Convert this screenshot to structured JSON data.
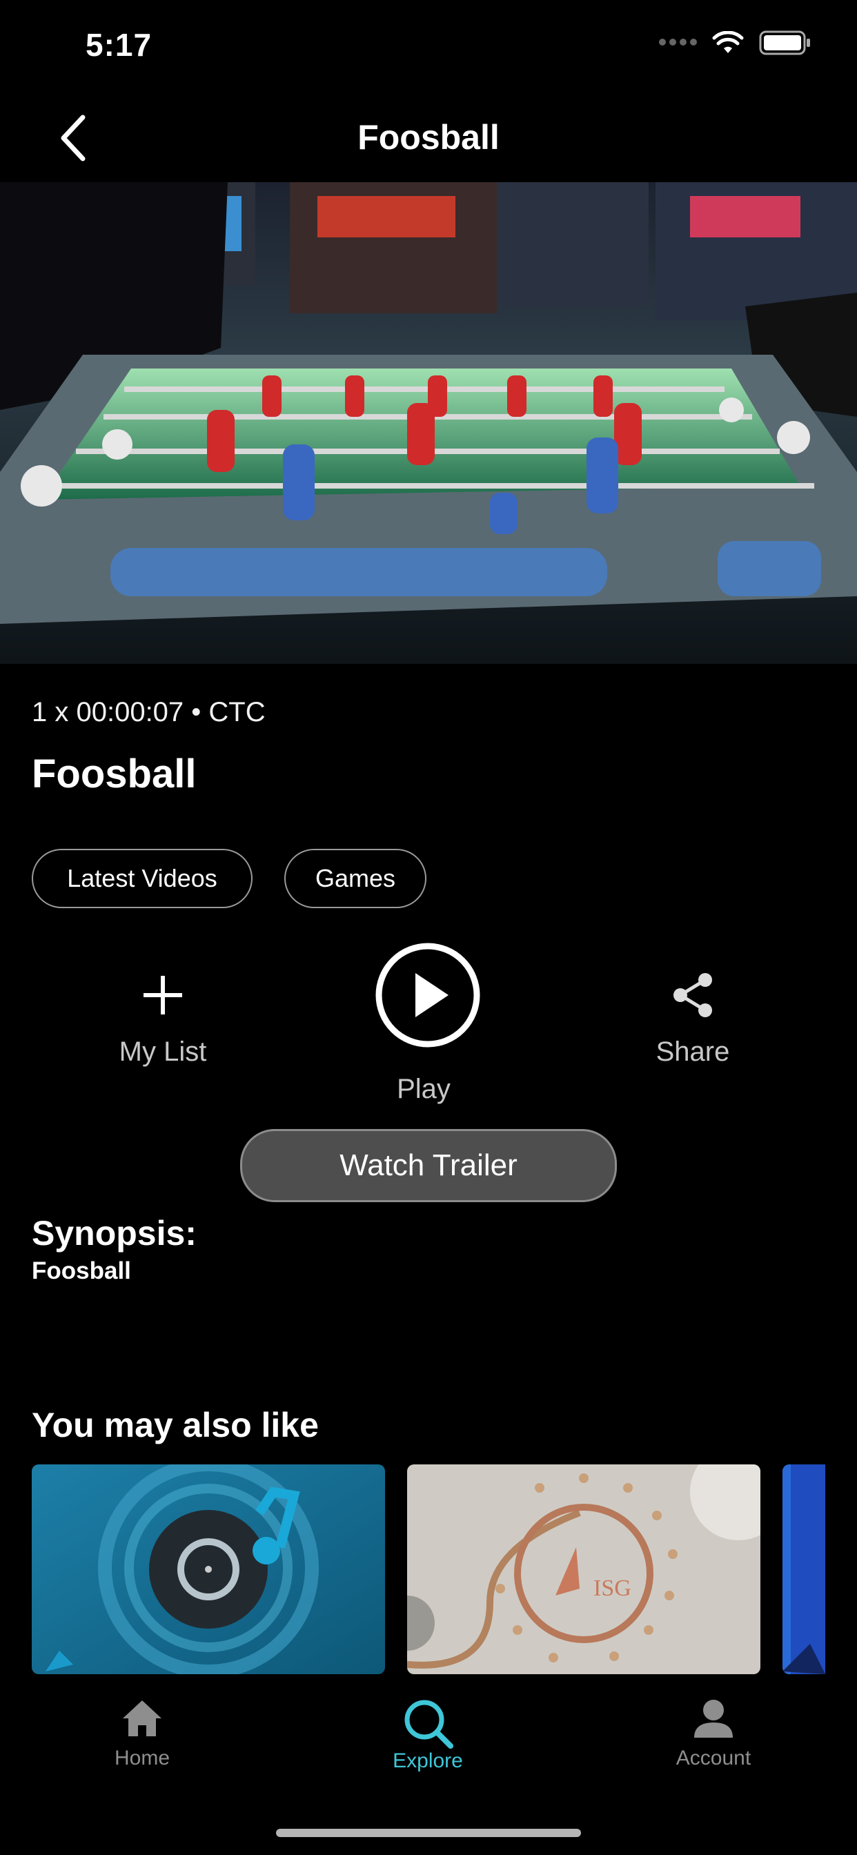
{
  "status_bar": {
    "time": "5:17"
  },
  "header": {
    "title": "Foosball"
  },
  "video": {
    "meta": "1 x 00:00:07  • CTC",
    "title": "Foosball",
    "tags": [
      "Latest Videos",
      "Games"
    ]
  },
  "actions": {
    "my_list": "My List",
    "play": "Play",
    "share": "Share",
    "watch_trailer": "Watch Trailer"
  },
  "synopsis": {
    "heading": "Synopsis:",
    "text": "Foosball"
  },
  "recommendations": {
    "heading": "You may also like"
  },
  "tab_bar": {
    "items": [
      {
        "label": "Home",
        "icon": "home-icon",
        "active": false
      },
      {
        "label": "Explore",
        "icon": "search-icon",
        "active": true
      },
      {
        "label": "Account",
        "icon": "account-icon",
        "active": false
      }
    ],
    "active_color": "#3fc6d8",
    "inactive_color": "#8e8e8e"
  }
}
